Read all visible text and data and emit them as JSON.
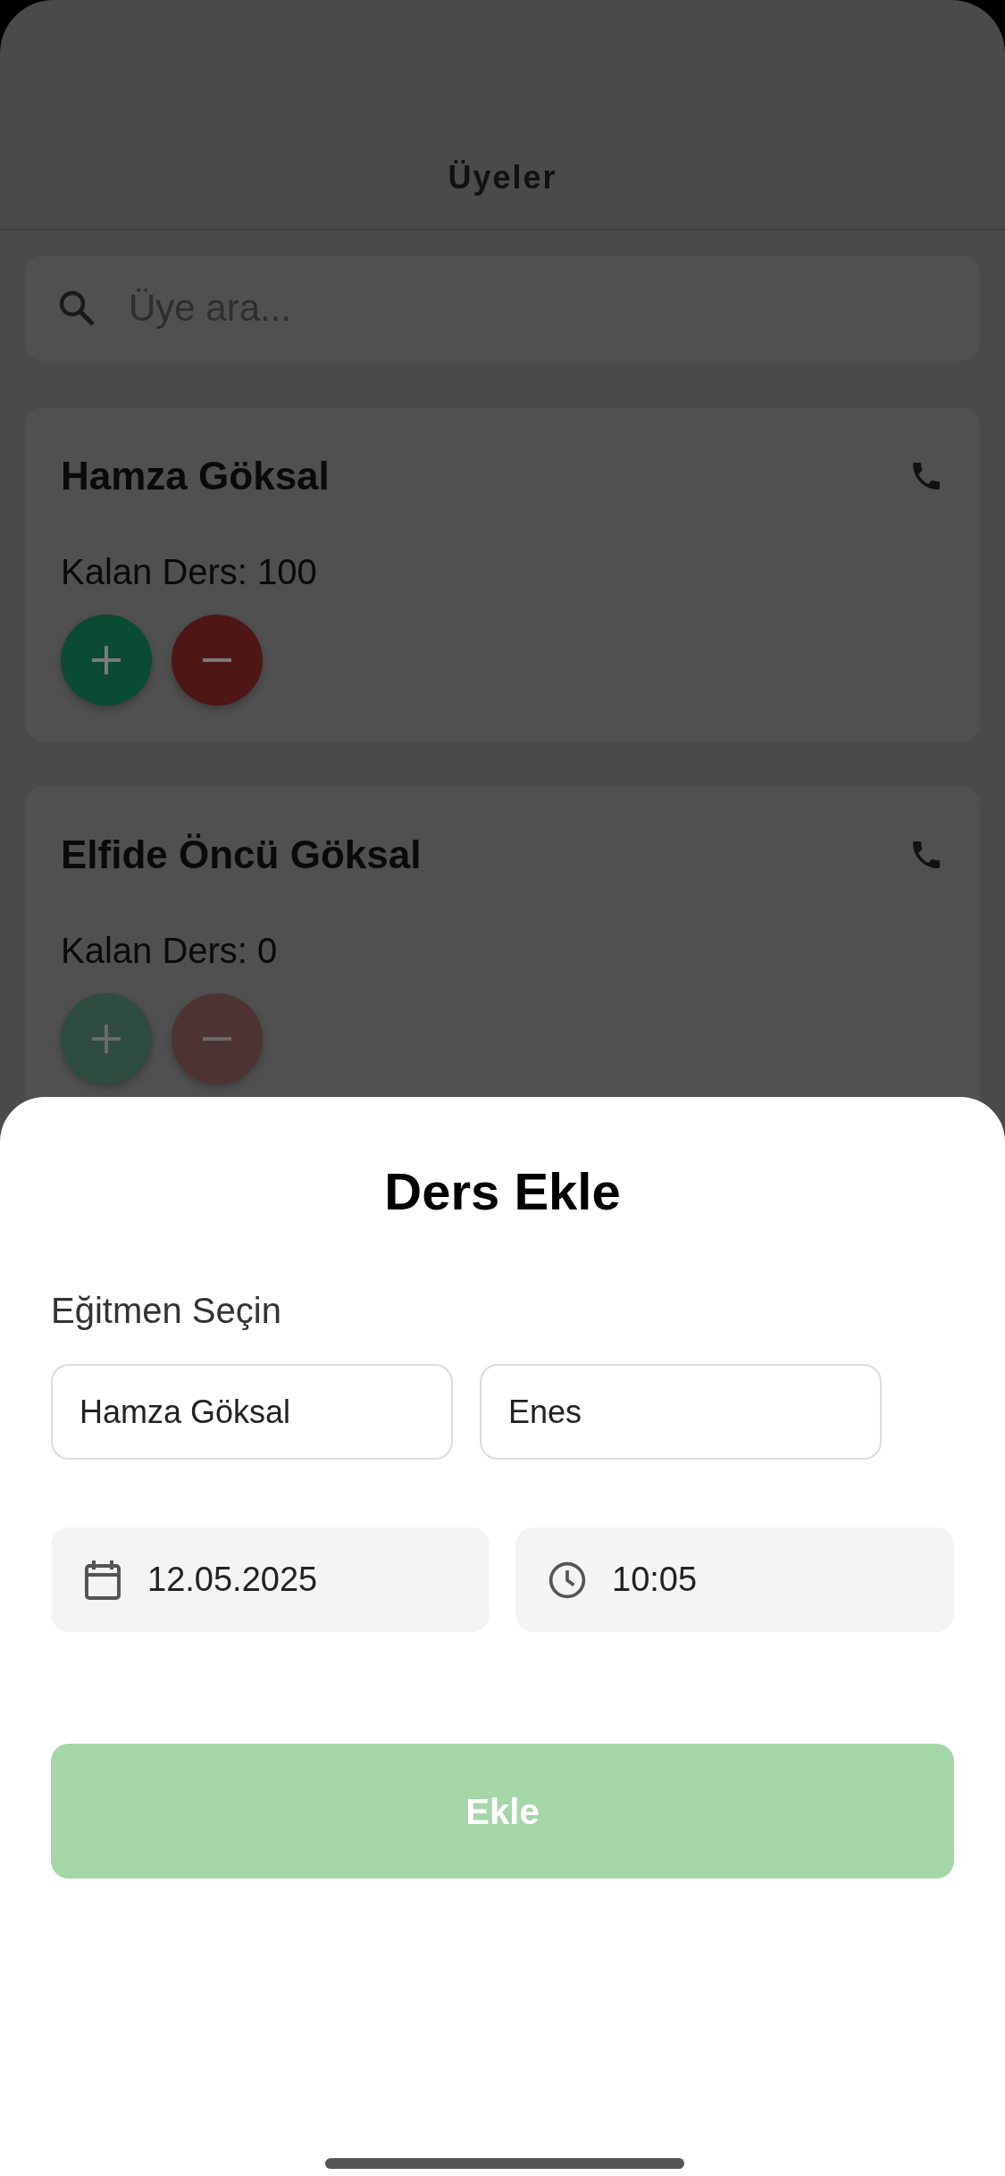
{
  "header": {
    "title": "Üyeler"
  },
  "search": {
    "placeholder": "Üye ara..."
  },
  "members": [
    {
      "name": "Hamza Göksal",
      "remaining": "Kalan Ders: 100",
      "disabled": false
    },
    {
      "name": "Elfide Öncü Göksal",
      "remaining": "Kalan Ders: 0",
      "disabled": true
    }
  ],
  "sheet": {
    "title": "Ders Ekle",
    "label": "Eğitmen Seçin",
    "instructors": [
      "Hamza Göksal",
      "Enes"
    ],
    "date": "12.05.2025",
    "time": "10:05",
    "submit": {
      "label": "Ekle",
      "disabled": true
    }
  }
}
